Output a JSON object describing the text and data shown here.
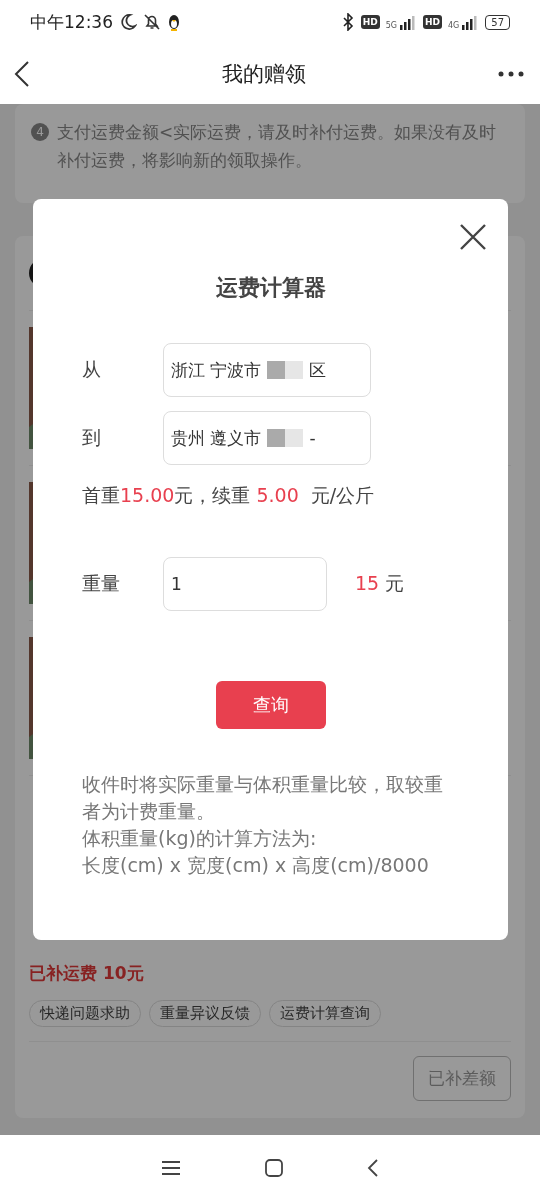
{
  "status_bar": {
    "time": "中午12:36",
    "sim1": {
      "badge": "HD",
      "network": "5G"
    },
    "sim2": {
      "badge": "HD",
      "network": "4G"
    },
    "battery": "57"
  },
  "nav": {
    "title": "我的赠领"
  },
  "notice": {
    "number": "4",
    "text": "支付运费金额<实际运费，请及时补付运费。如果没有及时补付运费，将影响新的领取操作。"
  },
  "order": {
    "paid_extra": "已补运费 10元",
    "tags": [
      "快递问题求助",
      "重量异议反馈",
      "运费计算查询"
    ],
    "action": {
      "label": "已补差额",
      "disabled": true
    }
  },
  "modal": {
    "title": "运费计算器",
    "from": {
      "label": "从",
      "value": "浙江 宁波市",
      "redacted": true,
      "suffix": "区"
    },
    "to": {
      "label": "到",
      "value": "贵州 遵义市",
      "redacted": true,
      "suffix": "-"
    },
    "rate": [
      {
        "text": "首重",
        "kind": "plain"
      },
      {
        "text": "15.00",
        "kind": "price"
      },
      {
        "text": "元，续重 ",
        "kind": "plain"
      },
      {
        "text": "5.00",
        "kind": "price"
      },
      {
        "text": "  元/公斤",
        "kind": "plain"
      }
    ],
    "weight": {
      "label": "重量",
      "value": "1",
      "result": "15",
      "unit": "元"
    },
    "button": "查询",
    "note": [
      "收件时将实际重量与体积重量比较，取较重者为计费重量。",
      "体积重量(kg)的计算方法为:",
      "长度(cm) x 宽度(cm) x 高度(cm)/8000"
    ]
  }
}
